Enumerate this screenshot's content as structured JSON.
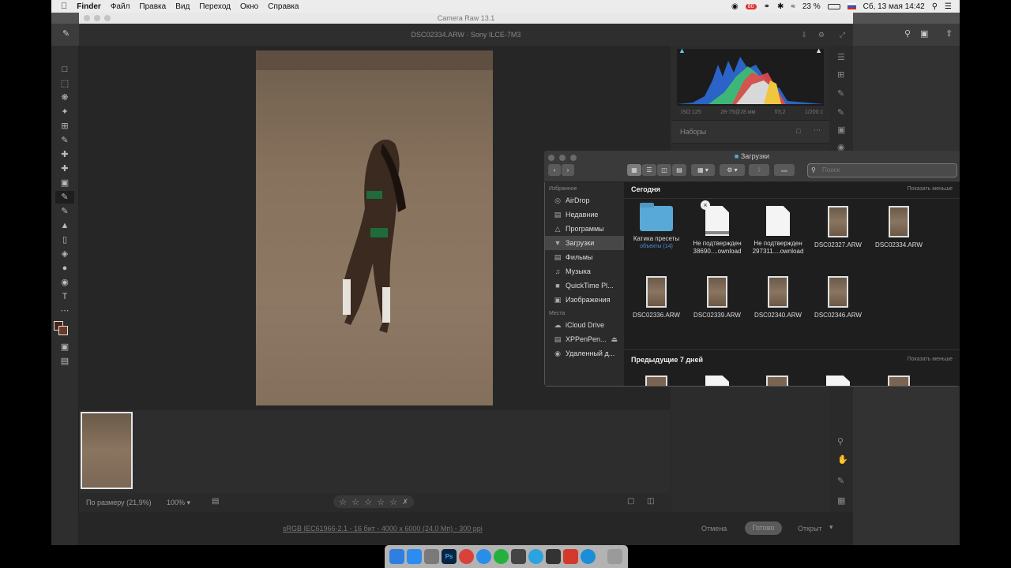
{
  "menubar": {
    "app": "Finder",
    "items": [
      "Файл",
      "Правка",
      "Вид",
      "Переход",
      "Окно",
      "Справка"
    ],
    "battery": "23 %",
    "datetime": "Сб, 13 мая  14:42",
    "badge": "80"
  },
  "camera_raw": {
    "window_title": "Camera Raw 13.1",
    "file_header": "DSC02334.ARW  ·  Sony ILCE-7M3",
    "exif": [
      "ISO 125",
      "28-75@28 мм",
      "f/3,2",
      "1/200 с"
    ],
    "presets_label": "Наборы",
    "zoom_fit": "По размеру (21,9%)",
    "zoom_value": "100%",
    "footer_info": "sRGB IEC61966-2.1 - 16 бит - 4000 x 6000 (24,0 Мп) - 300 ppi",
    "cancel_label": "Отмена",
    "done_label": "Готово",
    "open_label": "Открыт"
  },
  "finder": {
    "title": "Загрузки",
    "search_placeholder": "Поиск",
    "sidebar": {
      "favorites_label": "Избранное",
      "favorites": [
        {
          "label": "AirDrop",
          "icon": "airdrop-icon"
        },
        {
          "label": "Недавние",
          "icon": "recents-icon"
        },
        {
          "label": "Программы",
          "icon": "applications-icon"
        },
        {
          "label": "Загрузки",
          "icon": "downloads-icon"
        },
        {
          "label": "Фильмы",
          "icon": "movies-icon"
        },
        {
          "label": "Музыка",
          "icon": "music-icon"
        },
        {
          "label": "QuickTime Pl...",
          "icon": "folder-icon"
        },
        {
          "label": "Изображения",
          "icon": "pictures-icon"
        }
      ],
      "places_label": "Места",
      "places": [
        {
          "label": "iCloud Drive",
          "icon": "cloud-icon"
        },
        {
          "label": "XPPenPen...",
          "icon": "disk-icon"
        },
        {
          "label": "Удаленный д...",
          "icon": "remote-disc-icon"
        }
      ]
    },
    "today_label": "Сегодня",
    "show_less": "Показать меньше",
    "prev7_label": "Предыдущие 7 дней",
    "files_row1": [
      {
        "name": "Катика пресеты",
        "sub": "объекты (14)",
        "kind": "folder"
      },
      {
        "name": "Не подтвержден",
        "name2": "38690....ownload",
        "kind": "doc-cancel"
      },
      {
        "name": "Не подтвержден",
        "name2": "297311....ownload",
        "kind": "doc"
      },
      {
        "name": "DSC02327.ARW",
        "kind": "photo"
      },
      {
        "name": "DSC02334.ARW",
        "kind": "photo"
      }
    ],
    "files_row2": [
      {
        "name": "DSC02336.ARW",
        "kind": "photo"
      },
      {
        "name": "DSC02339.ARW",
        "kind": "photo"
      },
      {
        "name": "DSC02340.ARW",
        "kind": "photo"
      },
      {
        "name": "DSC02346.ARW",
        "kind": "photo"
      }
    ]
  },
  "dock": [
    {
      "icon": "finder-icon",
      "color": "#2f7fe0"
    },
    {
      "icon": "app-store-icon",
      "color": "#2d8cf0"
    },
    {
      "icon": "system-preferences-icon",
      "color": "#7a7a7a"
    },
    {
      "icon": "photoshop-icon",
      "color": "#0b2540",
      "text": "Ps"
    },
    {
      "icon": "chrome-icon",
      "color": "#d9413a"
    },
    {
      "icon": "safari-icon",
      "color": "#2a8ee8"
    },
    {
      "icon": "whatsapp-icon",
      "color": "#25b03d"
    },
    {
      "icon": "xp-pen-icon",
      "color": "#444444"
    },
    {
      "icon": "telegram-icon",
      "color": "#2aa3e0"
    },
    {
      "icon": "inkscape-icon",
      "color": "#333333"
    },
    {
      "icon": "app-red-icon",
      "color": "#d33a2c"
    },
    {
      "icon": "edge-icon",
      "color": "#1a8fd8"
    },
    {
      "icon": "trash-icon",
      "color": "#9a9a9a"
    }
  ]
}
